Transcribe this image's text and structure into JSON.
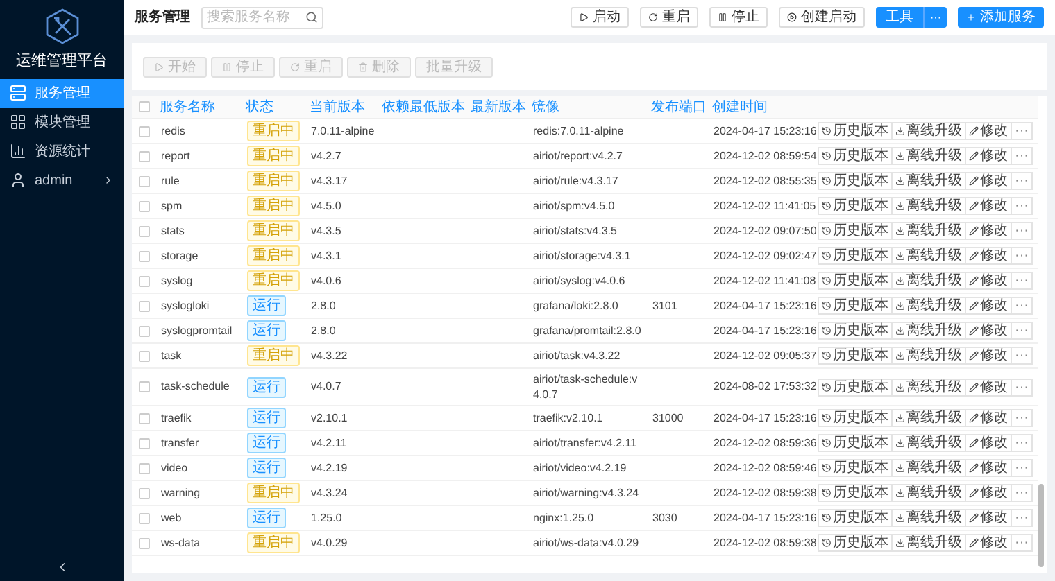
{
  "sidebar": {
    "title": "运维管理平台",
    "items": [
      {
        "label": "服务管理",
        "kind": "service",
        "selected": true
      },
      {
        "label": "模块管理",
        "kind": "module",
        "selected": false
      },
      {
        "label": "资源统计",
        "kind": "stats",
        "selected": false
      },
      {
        "label": "admin",
        "kind": "user",
        "selected": false
      }
    ]
  },
  "header": {
    "title": "服务管理",
    "search": {
      "placeholder": "搜索服务名称"
    },
    "buttons": [
      {
        "label": "启动",
        "kind": "play"
      },
      {
        "label": "重启",
        "kind": "restart"
      },
      {
        "label": "停止",
        "kind": "pause"
      },
      {
        "label": "创建启动",
        "kind": "create"
      },
      {
        "label": "工具",
        "kind": "split",
        "more": "···"
      },
      {
        "label": "添加服务",
        "kind": "add"
      }
    ]
  },
  "toolbar": {
    "buttons": [
      {
        "label": "开始",
        "kind": "play",
        "disabled": true
      },
      {
        "label": "停止",
        "kind": "pause",
        "disabled": true
      },
      {
        "label": "重启",
        "kind": "restart",
        "disabled": true
      },
      {
        "label": "删除",
        "kind": "delete",
        "disabled": true
      },
      {
        "label": "批量升级",
        "kind": "plain",
        "disabled": true
      }
    ]
  },
  "table": {
    "header_checked": false,
    "columns": [
      "服务名称",
      "状态",
      "当前版本",
      "依赖最低版本",
      "最新版本",
      "镜像",
      "发布端口",
      "创建时间"
    ],
    "rows": [
      {
        "name": "redis",
        "status": {
          "text": "重启中",
          "kind": "restarting"
        },
        "version": "7.0.11-alpine",
        "image": "redis:7.0.11-alpine",
        "port": "",
        "created": "2024-04-17 15:23:16",
        "checked": false,
        "actions": [
          "历史版本",
          "离线升级",
          "修改",
          "···"
        ]
      },
      {
        "name": "report",
        "status": {
          "text": "重启中",
          "kind": "restarting"
        },
        "version": "v4.2.7",
        "image": "airiot/report:v4.2.7",
        "port": "",
        "created": "2024-12-02 08:59:54",
        "checked": false,
        "actions": [
          "历史版本",
          "离线升级",
          "修改",
          "···"
        ]
      },
      {
        "name": "rule",
        "status": {
          "text": "重启中",
          "kind": "restarting"
        },
        "version": "v4.3.17",
        "image": "airiot/rule:v4.3.17",
        "port": "",
        "created": "2024-12-02 08:55:35",
        "checked": false,
        "actions": [
          "历史版本",
          "离线升级",
          "修改",
          "···"
        ]
      },
      {
        "name": "spm",
        "status": {
          "text": "重启中",
          "kind": "restarting"
        },
        "version": "v4.5.0",
        "image": "airiot/spm:v4.5.0",
        "port": "",
        "created": "2024-12-02 11:41:05",
        "checked": false,
        "actions": [
          "历史版本",
          "离线升级",
          "修改",
          "···"
        ]
      },
      {
        "name": "stats",
        "status": {
          "text": "重启中",
          "kind": "restarting"
        },
        "version": "v4.3.5",
        "image": "airiot/stats:v4.3.5",
        "port": "",
        "created": "2024-12-02 09:07:50",
        "checked": false,
        "actions": [
          "历史版本",
          "离线升级",
          "修改",
          "···"
        ]
      },
      {
        "name": "storage",
        "status": {
          "text": "重启中",
          "kind": "restarting"
        },
        "version": "v4.3.1",
        "image": "airiot/storage:v4.3.1",
        "port": "",
        "created": "2024-12-02 09:02:47",
        "checked": false,
        "actions": [
          "历史版本",
          "离线升级",
          "修改",
          "···"
        ]
      },
      {
        "name": "syslog",
        "status": {
          "text": "重启中",
          "kind": "restarting"
        },
        "version": "v4.0.6",
        "image": "airiot/syslog:v4.0.6",
        "port": "",
        "created": "2024-12-02 11:41:08",
        "checked": false,
        "actions": [
          "历史版本",
          "离线升级",
          "修改",
          "···"
        ]
      },
      {
        "name": "syslogloki",
        "status": {
          "text": "运行",
          "kind": "running"
        },
        "version": "2.8.0",
        "image": "grafana/loki:2.8.0",
        "port": "3101",
        "created": "2024-04-17 15:23:16",
        "checked": false,
        "actions": [
          "历史版本",
          "离线升级",
          "修改",
          "···"
        ]
      },
      {
        "name": "syslogpromtail",
        "status": {
          "text": "运行",
          "kind": "running"
        },
        "version": "2.8.0",
        "image": "grafana/promtail:2.8.0",
        "port": "",
        "created": "2024-04-17 15:23:16",
        "checked": false,
        "actions": [
          "历史版本",
          "离线升级",
          "修改",
          "···"
        ]
      },
      {
        "name": "task",
        "status": {
          "text": "重启中",
          "kind": "restarting"
        },
        "version": "v4.3.22",
        "image": "airiot/task:v4.3.22",
        "port": "",
        "created": "2024-12-02 09:05:37",
        "checked": false,
        "actions": [
          "历史版本",
          "离线升级",
          "修改",
          "···"
        ]
      },
      {
        "name": "task-schedule",
        "status": {
          "text": "运行",
          "kind": "running"
        },
        "version": "v4.0.7",
        "image": "airiot/task-schedule:v4.0.7",
        "port": "",
        "created": "2024-08-02 17:53:32",
        "checked": false,
        "actions": [
          "历史版本",
          "离线升级",
          "修改",
          "···"
        ]
      },
      {
        "name": "traefik",
        "status": {
          "text": "运行",
          "kind": "running"
        },
        "version": "v2.10.1",
        "image": "traefik:v2.10.1",
        "port": "31000",
        "created": "2024-04-17 15:23:16",
        "checked": false,
        "actions": [
          "历史版本",
          "离线升级",
          "修改",
          "···"
        ]
      },
      {
        "name": "transfer",
        "status": {
          "text": "运行",
          "kind": "running"
        },
        "version": "v4.2.11",
        "image": "airiot/transfer:v4.2.11",
        "port": "",
        "created": "2024-12-02 08:59:36",
        "checked": false,
        "actions": [
          "历史版本",
          "离线升级",
          "修改",
          "···"
        ]
      },
      {
        "name": "video",
        "status": {
          "text": "运行",
          "kind": "running"
        },
        "version": "v4.2.19",
        "image": "airiot/video:v4.2.19",
        "port": "",
        "created": "2024-12-02 08:59:46",
        "checked": false,
        "actions": [
          "历史版本",
          "离线升级",
          "修改",
          "···"
        ]
      },
      {
        "name": "warning",
        "status": {
          "text": "重启中",
          "kind": "restarting"
        },
        "version": "v4.3.24",
        "image": "airiot/warning:v4.3.24",
        "port": "",
        "created": "2024-12-02 08:59:38",
        "checked": false,
        "actions": [
          "历史版本",
          "离线升级",
          "修改",
          "···"
        ]
      },
      {
        "name": "web",
        "status": {
          "text": "运行",
          "kind": "running"
        },
        "version": "1.25.0",
        "image": "nginx:1.25.0",
        "port": "3030",
        "created": "2024-04-17 15:23:16",
        "checked": false,
        "actions": [
          "历史版本",
          "离线升级",
          "修改",
          "···"
        ]
      },
      {
        "name": "ws-data",
        "status": {
          "text": "重启中",
          "kind": "restarting"
        },
        "version": "v4.0.29",
        "image": "airiot/ws-data:v4.0.29",
        "port": "",
        "created": "2024-12-02 08:59:38",
        "checked": false,
        "actions": [
          "历史版本",
          "离线升级",
          "修改",
          "···"
        ]
      }
    ]
  }
}
